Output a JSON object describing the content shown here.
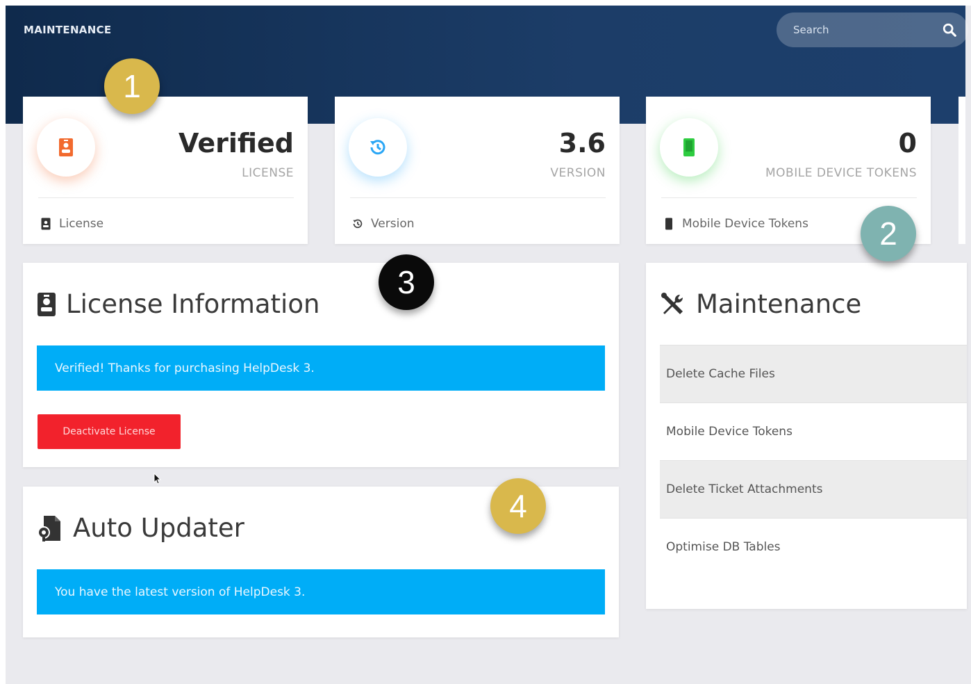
{
  "header": {
    "title": "MAINTENANCE",
    "search_placeholder": "Search"
  },
  "stats": [
    {
      "value": "Verified",
      "sublabel": "LICENSE",
      "footer": "License",
      "icon": "id-badge-icon",
      "color": "#f26a2e"
    },
    {
      "value": "3.6",
      "sublabel": "VERSION",
      "footer": "Version",
      "icon": "history-icon",
      "color": "#2aa6f5"
    },
    {
      "value": "0",
      "sublabel": "MOBILE DEVICE TOKENS",
      "footer": "Mobile Device Tokens",
      "icon": "mobile-icon",
      "color": "#2ecc40"
    }
  ],
  "license_panel": {
    "title": "License Information",
    "alert": "Verified! Thanks for purchasing HelpDesk 3.",
    "deactivate_label": "Deactivate License"
  },
  "updater_panel": {
    "title": "Auto Updater",
    "alert": "You have the latest version of HelpDesk 3."
  },
  "maintenance_panel": {
    "title": "Maintenance",
    "items": [
      "Delete Cache Files",
      "Mobile Device Tokens",
      "Delete Ticket Attachments",
      "Optimise DB Tables"
    ]
  },
  "callouts": [
    {
      "label": "1",
      "color": "#d9b84c"
    },
    {
      "label": "2",
      "color": "#7fb3b0"
    },
    {
      "label": "3",
      "color": "#0a0a0a"
    },
    {
      "label": "4",
      "color": "#d9b84c"
    }
  ],
  "colors": {
    "topbar": "#1c3d68",
    "alert": "#00adf7",
    "danger": "#f2222c"
  }
}
